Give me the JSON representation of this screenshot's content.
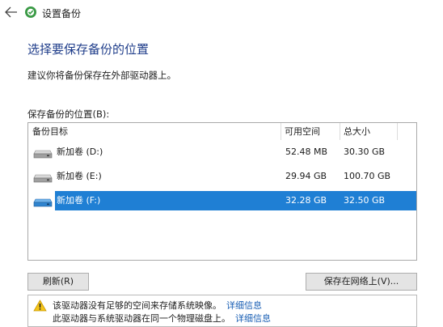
{
  "window": {
    "title": "设置备份"
  },
  "page": {
    "heading": "选择要保存备份的位置",
    "subtitle": "建议你将备份保存在外部驱动器上。",
    "list_label": "保存备份的位置(B):"
  },
  "table": {
    "columns": [
      "备份目标",
      "可用空间",
      "总大小"
    ],
    "rows": [
      {
        "name": "新加卷 (D:)",
        "free": "52.48 MB",
        "total": "30.30 GB",
        "selected": false,
        "icon": "drive-icon"
      },
      {
        "name": "新加卷 (E:)",
        "free": "29.94 GB",
        "total": "100.70 GB",
        "selected": false,
        "icon": "drive-icon"
      },
      {
        "name": "新加卷 (F:)",
        "free": "32.28 GB",
        "total": "32.50 GB",
        "selected": true,
        "icon": "drive-icon"
      }
    ]
  },
  "buttons": {
    "refresh": "刷新(R)",
    "network": "保存在网络上(V)..."
  },
  "warnings": [
    {
      "text": "该驱动器没有足够的空间来存储系统映像。",
      "link": "详细信息"
    },
    {
      "text": "此驱动器与系统驱动器在同一个物理磁盘上。",
      "link": "详细信息"
    }
  ],
  "colors": {
    "accent": "#1f7fd4",
    "heading": "#1f3d8a",
    "link": "#1a5fb4"
  }
}
